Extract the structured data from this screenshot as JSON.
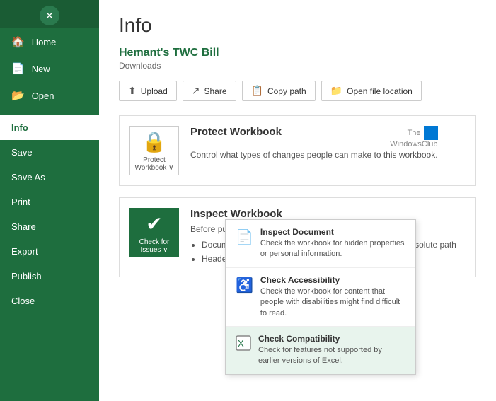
{
  "sidebar": {
    "top_icon": "⊙",
    "items": [
      {
        "id": "home",
        "label": "Home",
        "icon": "🏠",
        "active": false
      },
      {
        "id": "new",
        "label": "New",
        "icon": "📄",
        "active": false
      },
      {
        "id": "open",
        "label": "Open",
        "icon": "📂",
        "active": false
      },
      {
        "id": "info",
        "label": "Info",
        "icon": "",
        "active": true
      },
      {
        "id": "save",
        "label": "Save",
        "icon": "",
        "active": false
      },
      {
        "id": "saveas",
        "label": "Save As",
        "icon": "",
        "active": false
      },
      {
        "id": "print",
        "label": "Print",
        "icon": "",
        "active": false
      },
      {
        "id": "share",
        "label": "Share",
        "icon": "",
        "active": false
      },
      {
        "id": "export",
        "label": "Export",
        "icon": "",
        "active": false
      },
      {
        "id": "publish",
        "label": "Publish",
        "icon": "",
        "active": false
      },
      {
        "id": "close",
        "label": "Close",
        "icon": "",
        "active": false
      }
    ]
  },
  "page": {
    "title": "Info",
    "file_title": "Hemant's TWC Bill",
    "file_location": "Downloads"
  },
  "action_buttons": [
    {
      "id": "upload",
      "label": "Upload",
      "icon": "⬆"
    },
    {
      "id": "share",
      "label": "Share",
      "icon": "↗"
    },
    {
      "id": "copy_path",
      "label": "Copy path",
      "icon": "📋"
    },
    {
      "id": "open_file_location",
      "label": "Open file location",
      "icon": "📁"
    }
  ],
  "sections": [
    {
      "id": "protect",
      "icon_label": "Protect\nWorkbook ∨",
      "title": "Protect Workbook",
      "description": "Control what types of changes people can make to this workbook.",
      "green": false
    },
    {
      "id": "inspect",
      "icon_label": "Check for\nIssues ∨",
      "title": "Inspect Workbook",
      "description": "Before publishing this file, be aware that it contains:",
      "bullets": [
        "Document properties, printer path, author's name and absolute path",
        "Headers"
      ],
      "green": true
    }
  ],
  "dropdown": {
    "items": [
      {
        "id": "inspect_doc",
        "title": "Inspect Document",
        "desc": "Check the workbook for hidden properties or personal information.",
        "icon": "📄",
        "highlighted": false
      },
      {
        "id": "check_accessibility",
        "title": "Check Accessibility",
        "desc": "Check the workbook for content that people with disabilities might find difficult to read.",
        "icon": "♿",
        "highlighted": false
      },
      {
        "id": "check_compatibility",
        "title": "Check Compatibility",
        "desc": "Check for features not supported by earlier versions of Excel.",
        "icon": "📊",
        "highlighted": true
      }
    ]
  },
  "watermark": {
    "line1": "The",
    "line2": "WindowsClub"
  }
}
